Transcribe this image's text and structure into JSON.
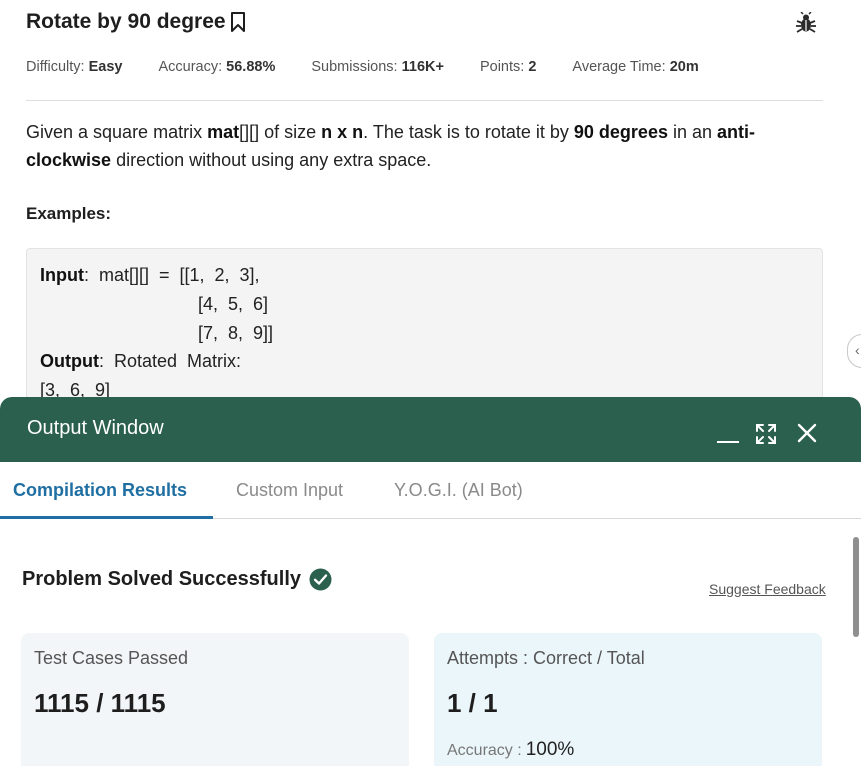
{
  "problem": {
    "title": "Rotate by 90 degree",
    "meta": [
      {
        "label": "Difficulty:",
        "value": "Easy"
      },
      {
        "label": "Accuracy:",
        "value": "56.88%"
      },
      {
        "label": "Submissions:",
        "value": "116K+"
      },
      {
        "label": "Points:",
        "value": "2"
      },
      {
        "label": "Average Time:",
        "value": "20m"
      }
    ],
    "description": {
      "p1": "Given a square matrix ",
      "b1": "mat",
      "p2": "[][] of size ",
      "b2": "n x n",
      "p3": ". The task is to rotate it by ",
      "b3": "90 degrees",
      "p4": " in an ",
      "b4": "anti-clockwise",
      "p5": " direction without using any extra space."
    },
    "examples_label": "Examples:",
    "example": {
      "input_label": "Input",
      "input_line1": ":  mat[][]  =  [[1,  2,  3],",
      "input_line2": "[4,  5,  6]",
      "input_line3": "[7,  8,  9]]",
      "output_label": "Output",
      "output_line1": ":  Rotated  Matrix:",
      "output_line2": "[3,  6,  9]"
    }
  },
  "output_window": {
    "title": "Output Window",
    "tabs": [
      "Compilation Results",
      "Custom Input",
      "Y.O.G.I. (AI Bot)"
    ],
    "active_tab": 0,
    "status_title": "Problem Solved Successfully",
    "feedback_link": "Suggest Feedback",
    "test_cases": {
      "label": "Test Cases Passed",
      "value": "1115 / 1115"
    },
    "attempts": {
      "label": "Attempts : Correct / Total",
      "value": "1 / 1",
      "accuracy_label": "Accuracy :",
      "accuracy_value": "100%"
    }
  },
  "icons": {
    "bookmark": "bookmark-icon",
    "bug": "bug-icon",
    "minimize": "minimize-icon",
    "maximize": "maximize-icon",
    "close": "close-icon",
    "check": "check-circle-icon",
    "sidebar_toggle": "chevron-left-icon"
  },
  "colors": {
    "header_green": "#2a604d",
    "tab_active": "#1f6fa3",
    "success_green": "#2a604d",
    "card_left_bg": "#f3f6f8",
    "card_right_bg": "#ebf6fa"
  }
}
